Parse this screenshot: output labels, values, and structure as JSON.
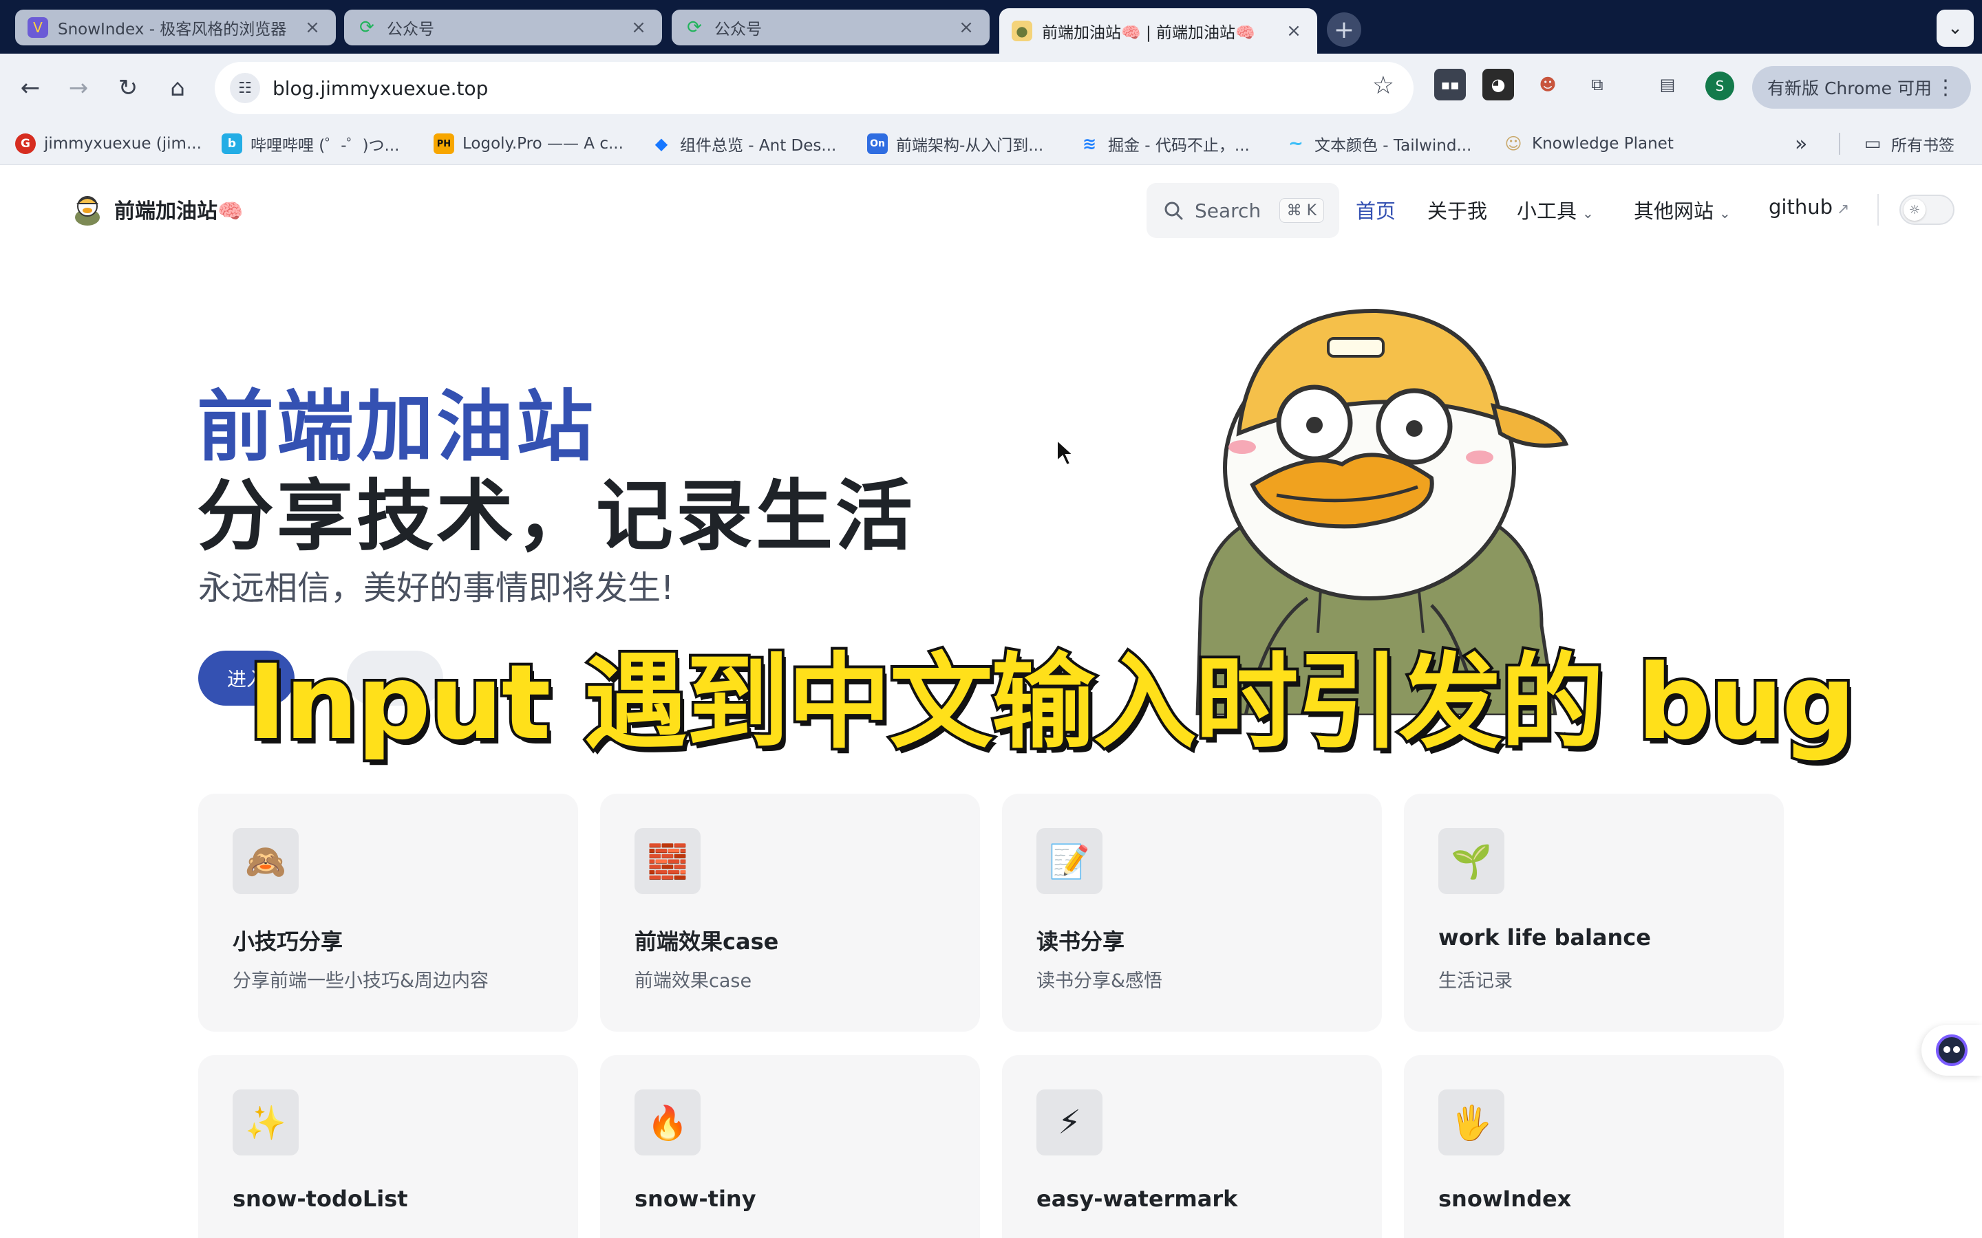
{
  "browser": {
    "tabs": [
      {
        "title": "SnowIndex - 极客风格的浏览器",
        "favicon": "snowindex-logo-icon"
      },
      {
        "title": "公众号",
        "favicon": "wechat-mp-icon"
      },
      {
        "title": "公众号",
        "favicon": "wechat-mp-icon"
      },
      {
        "title": "前端加油站🧠 | 前端加油站🧠",
        "favicon": "duck-avatar-icon",
        "active": true
      }
    ],
    "address": "blog.jimmyxuexue.top",
    "update_label": "有新版 Chrome 可用",
    "profile_initial": "S",
    "bookmarks": [
      {
        "label": "jimmyxuexue (jim...",
        "color": "#d62d20",
        "glyph": "G"
      },
      {
        "label": "哔哩哔哩 (゜-゜)つ...",
        "color": "#23ade5",
        "glyph": "b"
      },
      {
        "label": "Logoly.Pro —— A c...",
        "color": "#f7a600",
        "glyph": "PH"
      },
      {
        "label": "组件总览 - Ant Des...",
        "color": "#1677ff",
        "glyph": "◆"
      },
      {
        "label": "前端架构-从入门到...",
        "color": "#2f6de1",
        "glyph": "On"
      },
      {
        "label": "掘金 - 代码不止，...",
        "color": "#1e80ff",
        "glyph": "≋"
      },
      {
        "label": "文本颜色 - Tailwind...",
        "color": "#38bdf8",
        "glyph": "~"
      },
      {
        "label": "Knowledge Planet",
        "color": "#c9a86a",
        "glyph": "☺"
      }
    ],
    "all_bookmarks": "所有书签"
  },
  "site": {
    "logo_text": "前端加油站🧠",
    "search": {
      "label": "Search",
      "shortcut": "⌘ K"
    },
    "nav": [
      {
        "label": "首页",
        "active": true
      },
      {
        "label": "关于我"
      },
      {
        "label": "小工具",
        "dropdown": true
      },
      {
        "label": "其他网站",
        "dropdown": true
      },
      {
        "label": "github",
        "external": true
      }
    ]
  },
  "hero": {
    "name": "前端加油站",
    "text": "分享技术，记录生活",
    "tagline": "永远相信，美好的事情即将发生!",
    "primary_action": "进入",
    "secondary_action": ""
  },
  "overlay_caption": "Input 遇到中文输入时引发的 bug",
  "features": [
    {
      "icon": "🙈",
      "title": "小技巧分享",
      "details": "分享前端一些小技巧&周边内容"
    },
    {
      "icon": "🧱",
      "title": "前端效果case",
      "details": "前端效果case"
    },
    {
      "icon": "📝",
      "title": "读书分享",
      "details": "读书分享&感悟"
    },
    {
      "icon": "🌱",
      "title": "work life balance",
      "details": "生活记录"
    },
    {
      "icon": "✨",
      "title": "snow-todoList",
      "details": ""
    },
    {
      "icon": "🔥",
      "title": "snow-tiny",
      "details": ""
    },
    {
      "icon": "⚡",
      "title": "easy-watermark",
      "details": ""
    },
    {
      "icon": "🖐",
      "title": "snowIndex",
      "details": ""
    }
  ],
  "colors": {
    "brand": "#3451b2",
    "caption": "#ffe01a",
    "chrome_dark": "#0c1b3d"
  }
}
